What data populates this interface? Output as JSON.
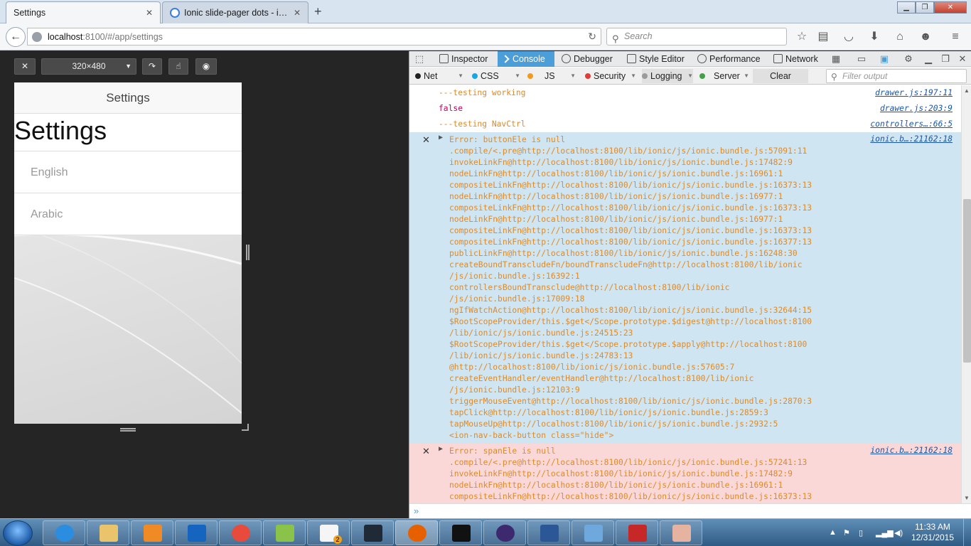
{
  "browser": {
    "tabs": [
      {
        "label": "Settings",
        "active": true
      },
      {
        "label": "Ionic slide-pager dots - ion...",
        "active": false
      }
    ],
    "url_host": "localhost",
    "url_rest": ":8100/#/app/settings",
    "search_placeholder": "Search"
  },
  "rdm": {
    "size_label": "320×480"
  },
  "app": {
    "header_title": "Settings",
    "page_title": "Settings",
    "languages": [
      "English",
      "Arabic"
    ]
  },
  "devtools": {
    "tabs": [
      "Inspector",
      "Console",
      "Debugger",
      "Style Editor",
      "Performance",
      "Network"
    ],
    "active_tab": "Console",
    "filters": [
      {
        "label": "Net",
        "color": "#222222"
      },
      {
        "label": "CSS",
        "color": "#1aa6e2"
      },
      {
        "label": "JS",
        "color": "#f29a1e"
      },
      {
        "label": "Security",
        "color": "#e23b3b"
      },
      {
        "label": "Logging",
        "color": "#9a9a9a"
      },
      {
        "label": "Server",
        "color": "#43a047"
      }
    ],
    "clear_label": "Clear",
    "filter_placeholder": "Filter output",
    "logs": [
      {
        "text": "---testing working",
        "loc": "drawer.js:197:11",
        "kind": "log"
      },
      {
        "text": "false",
        "loc": "drawer.js:203:9",
        "kind": "val"
      },
      {
        "text": "---testing NavCtrl",
        "loc": "controllers…:66:5",
        "kind": "log"
      }
    ],
    "errors": [
      {
        "loc": "ionic.b…:21162:18",
        "lines": [
          "Error: buttonEle is null",
          ".compile/<.pre@http://localhost:8100/lib/ionic/js/ionic.bundle.js:57091:11",
          "invokeLinkFn@http://localhost:8100/lib/ionic/js/ionic.bundle.js:17482:9",
          "nodeLinkFn@http://localhost:8100/lib/ionic/js/ionic.bundle.js:16961:1",
          "compositeLinkFn@http://localhost:8100/lib/ionic/js/ionic.bundle.js:16373:13",
          "nodeLinkFn@http://localhost:8100/lib/ionic/js/ionic.bundle.js:16977:1",
          "compositeLinkFn@http://localhost:8100/lib/ionic/js/ionic.bundle.js:16373:13",
          "nodeLinkFn@http://localhost:8100/lib/ionic/js/ionic.bundle.js:16977:1",
          "compositeLinkFn@http://localhost:8100/lib/ionic/js/ionic.bundle.js:16373:13",
          "compositeLinkFn@http://localhost:8100/lib/ionic/js/ionic.bundle.js:16377:13",
          "publicLinkFn@http://localhost:8100/lib/ionic/js/ionic.bundle.js:16248:30",
          "createBoundTranscludeFn/boundTranscludeFn@http://localhost:8100/lib/ionic",
          "/js/ionic.bundle.js:16392:1",
          "controllersBoundTransclude@http://localhost:8100/lib/ionic",
          "/js/ionic.bundle.js:17009:18",
          "ngIfWatchAction@http://localhost:8100/lib/ionic/js/ionic.bundle.js:32644:15",
          "$RootScopeProvider/this.$get</Scope.prototype.$digest@http://localhost:8100",
          "/lib/ionic/js/ionic.bundle.js:24515:23",
          "$RootScopeProvider/this.$get</Scope.prototype.$apply@http://localhost:8100",
          "/lib/ionic/js/ionic.bundle.js:24783:13",
          "@http://localhost:8100/lib/ionic/js/ionic.bundle.js:57605:7",
          "createEventHandler/eventHandler@http://localhost:8100/lib/ionic",
          "/js/ionic.bundle.js:12103:9",
          "triggerMouseEvent@http://localhost:8100/lib/ionic/js/ionic.bundle.js:2870:3",
          "tapClick@http://localhost:8100/lib/ionic/js/ionic.bundle.js:2859:3",
          "tapMouseUp@http://localhost:8100/lib/ionic/js/ionic.bundle.js:2932:5",
          "<ion-nav-back-button class=\"hide\">"
        ]
      },
      {
        "loc": "ionic.b…:21162:18",
        "lines": [
          "Error: spanEle is null",
          ".compile/<.pre@http://localhost:8100/lib/ionic/js/ionic.bundle.js:57241:13",
          "invokeLinkFn@http://localhost:8100/lib/ionic/js/ionic.bundle.js:17482:9",
          "nodeLinkFn@http://localhost:8100/lib/ionic/js/ionic.bundle.js:16961:1",
          "compositeLinkFn@http://localhost:8100/lib/ionic/js/ionic.bundle.js:16373:13"
        ]
      }
    ]
  },
  "taskbar": {
    "apps": [
      "internet-explorer",
      "file-explorer",
      "media-player",
      "outlook",
      "chrome",
      "android-studio",
      "notepad",
      "brackets",
      "firefox",
      "command-prompt",
      "eclipse",
      "word",
      "photo-viewer",
      "acrobat",
      "paint"
    ],
    "badge": "2",
    "time": "11:33 AM",
    "date": "12/31/2015"
  },
  "colors": {
    "console_log": "#e08a24",
    "console_value": "#c8005a",
    "error_blue_bg": "#d0e5f2",
    "error_pink_bg": "#fbd8d8",
    "devtools_accent": "#4c9ed9"
  }
}
